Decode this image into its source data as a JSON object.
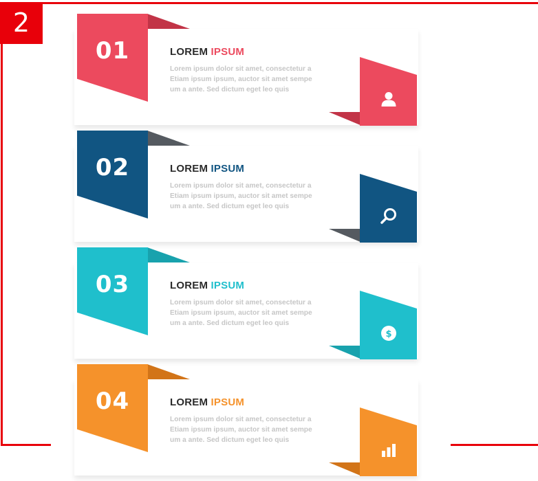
{
  "badge": "2",
  "steps": [
    {
      "number": "01",
      "title_main": "LOREM",
      "title_accent": "IPSUM",
      "lines": [
        "Lorem ipsum dolor sit amet, consectetur a",
        "Etiam ipsum ipsum, auctor sit amet sempe",
        "um a ante. Sed dictum eget leo quis"
      ],
      "icon": "user-icon",
      "color": "#ec4a5e"
    },
    {
      "number": "02",
      "title_main": "LOREM",
      "title_accent": "IPSUM",
      "lines": [
        "Lorem ipsum dolor sit amet, consectetur a",
        "Etiam ipsum ipsum, auctor sit amet sempe",
        "um a ante. Sed dictum eget leo quis"
      ],
      "icon": "search-icon",
      "color": "#115582"
    },
    {
      "number": "03",
      "title_main": "LOREM",
      "title_accent": "IPSUM",
      "lines": [
        "Lorem ipsum dolor sit amet, consectetur a",
        "Etiam ipsum ipsum, auctor sit amet sempe",
        "um a ante. Sed dictum eget leo quis"
      ],
      "icon": "dollar-coin-icon",
      "color": "#1fbfcc"
    },
    {
      "number": "04",
      "title_main": "LOREM",
      "title_accent": "IPSUM",
      "lines": [
        "Lorem ipsum dolor sit amet, consectetur a",
        "Etiam ipsum ipsum, auctor sit amet sempe",
        "um a ante. Sed dictum eget leo quis"
      ],
      "icon": "bar-chart-icon",
      "color": "#f5922b"
    }
  ]
}
